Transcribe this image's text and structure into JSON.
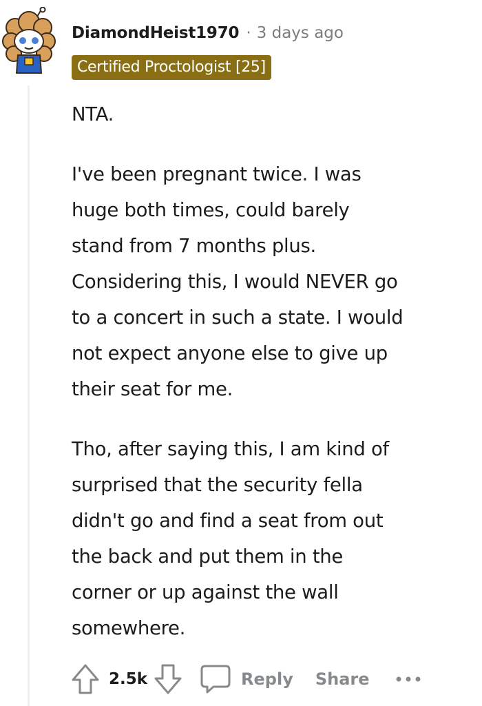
{
  "comment": {
    "author": "DiamondHeist1970",
    "separator": "·",
    "timestamp": "3 days ago",
    "flair": "Certified Proctologist [25]",
    "paragraphs": [
      "NTA.",
      "I've been pregnant twice. I was\nhuge both times, could barely\nstand from 7 months plus.\nConsidering this, I would NEVER go\nto a concert in such a state. I would\nnot expect anyone else to give up\ntheir seat for me.",
      "Tho, after saying this, I am kind of\nsurprised that the security fella\ndidn't go and find a seat from out\nthe back and put them in the\ncorner or up against the wall\nsomewhere."
    ]
  },
  "actions": {
    "score": "2.5k",
    "reply_label": "Reply",
    "share_label": "Share"
  },
  "colors": {
    "flair_bg": "#8a6e13",
    "meta_text": "#7c7c7c",
    "action_text": "#878a8c",
    "thread_line": "#edeff1"
  },
  "icons": {
    "upvote": "upvote-arrow-icon",
    "downvote": "downvote-arrow-icon",
    "reply": "speech-bubble-icon",
    "more": "ellipsis-icon"
  }
}
